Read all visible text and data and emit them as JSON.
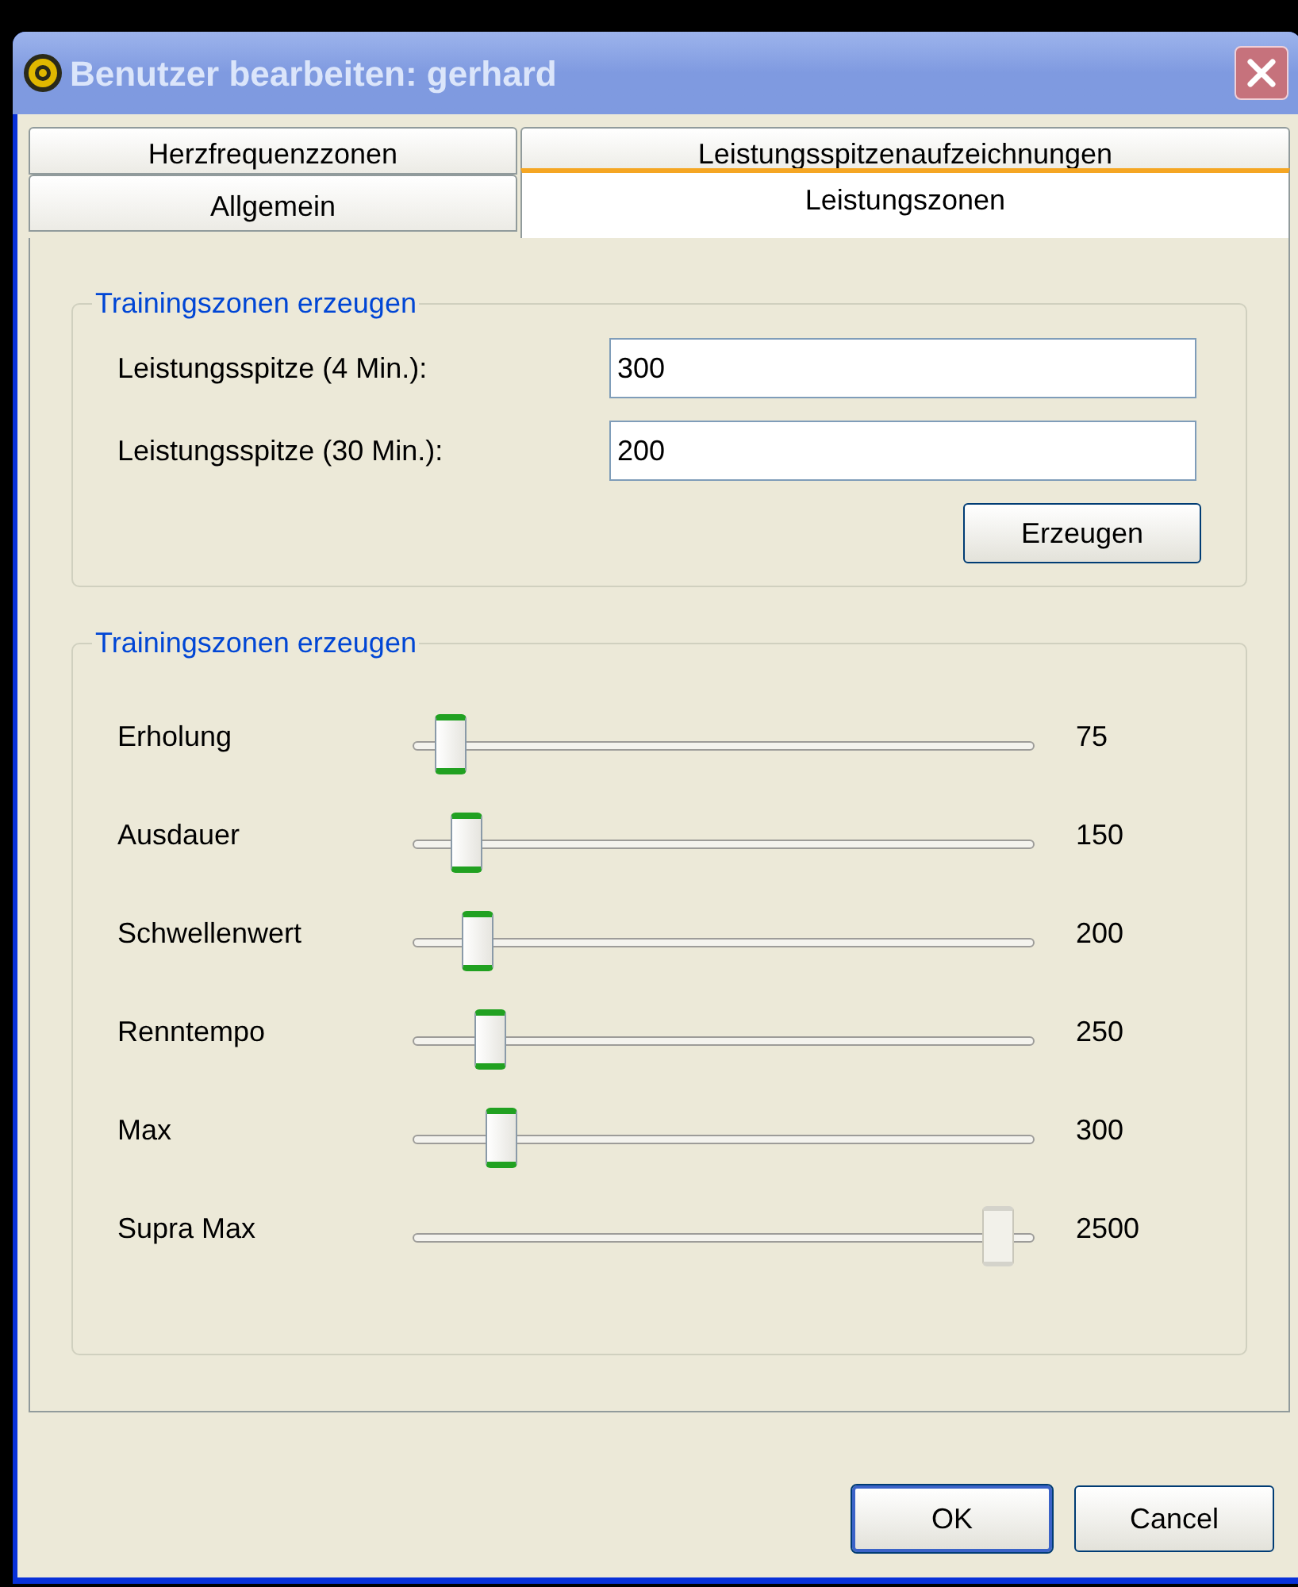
{
  "window": {
    "title": "Benutzer bearbeiten: gerhard"
  },
  "tab_rows": [
    [
      {
        "label": "Herzfrequenzzonen",
        "selected": false
      },
      {
        "label": "Leistungsspitzenaufzeichnungen",
        "selected": false
      }
    ],
    [
      {
        "label": "Allgemein",
        "selected": false
      },
      {
        "label": "Leistungszonen",
        "selected": true
      }
    ]
  ],
  "peak_group": {
    "title": "Trainingszonen erzeugen",
    "fields": [
      {
        "label": "Leistungsspitze (4 Min.):",
        "value": "300"
      },
      {
        "label": "Leistungsspitze (30 Min.):",
        "value": "200"
      }
    ],
    "button": "Erzeugen"
  },
  "zones_group": {
    "title": "Trainingszonen erzeugen",
    "zones": [
      {
        "name": "Erholung",
        "level": 0.03,
        "reading": "75",
        "disabled": false
      },
      {
        "name": "Ausdauer",
        "level": 0.06,
        "reading": "150",
        "disabled": false
      },
      {
        "name": "Schwellenwert",
        "level": 0.08,
        "reading": "200",
        "disabled": false
      },
      {
        "name": "Renntempo",
        "level": 0.1,
        "reading": "250",
        "disabled": false
      },
      {
        "name": "Max",
        "level": 0.12,
        "reading": "300",
        "disabled": false
      },
      {
        "name": "Supra Max",
        "level": 1,
        "reading": "2500",
        "disabled": true
      }
    ]
  },
  "buttons": [
    {
      "label": "OK",
      "kind": "default"
    },
    {
      "label": "Cancel",
      "kind": "normal"
    }
  ]
}
